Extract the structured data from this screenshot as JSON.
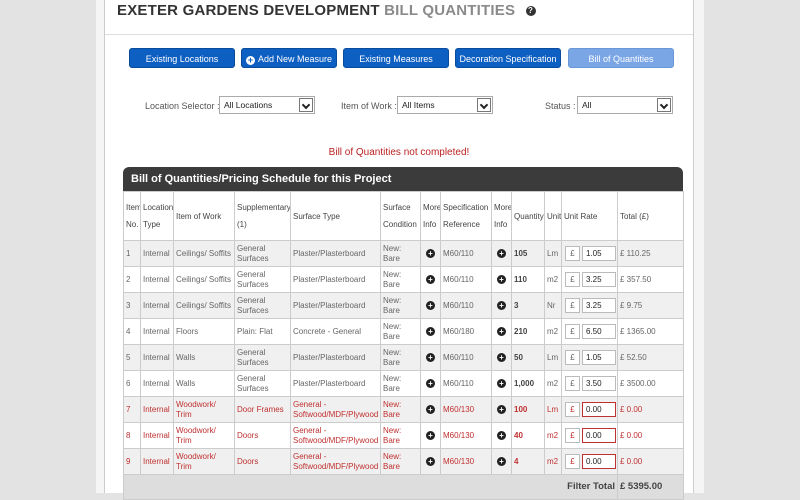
{
  "header": {
    "title_main": "EXETER GARDENS DEVELOPMENT",
    "title_sub": "BILL QUANTITIES",
    "help_glyph": "?"
  },
  "nav": {
    "existing_locations": "Existing Locations",
    "add_new_measure": "Add New Measure",
    "existing_measures": "Existing Measures",
    "decoration_specification": "Decoration Specification",
    "bill_of_quantities": "Bill of Quantities"
  },
  "filters": {
    "location_label": "Location Selector :",
    "location_value": "All Locations",
    "item_label": "Item of Work :",
    "item_value": "All Items",
    "status_label": "Status :",
    "status_value": "All"
  },
  "warning": "Bill of Quantities not completed!",
  "table": {
    "heading": "Bill of Quantities/Pricing Schedule for this Project",
    "columns": [
      "Item No.",
      "Location Type",
      "Item of Work",
      "Supplementary (1)",
      "Surface Type",
      "Surface Condition",
      "More Info",
      "Specification Reference",
      "More Info",
      "Quantity",
      "Unit",
      "Unit Rate",
      "Total (£)"
    ],
    "rows": [
      {
        "no": "1",
        "loc": "Internal",
        "item": "Ceilings/ Soffits",
        "supp": "General Surfaces",
        "surface": "Plaster/Plasterboard",
        "cond": "New: Bare",
        "spec": "M60/110",
        "qty": "105",
        "unit": "Lm",
        "cur": "£",
        "rate": "1.05",
        "total": "£ 110.25",
        "status": "done"
      },
      {
        "no": "2",
        "loc": "Internal",
        "item": "Ceilings/ Soffits",
        "supp": "General Surfaces",
        "surface": "Plaster/Plasterboard",
        "cond": "New: Bare",
        "spec": "M60/110",
        "qty": "110",
        "unit": "m2",
        "cur": "£",
        "rate": "3.25",
        "total": "£ 357.50",
        "status": "done"
      },
      {
        "no": "3",
        "loc": "Internal",
        "item": "Ceilings/ Soffits",
        "supp": "General Surfaces",
        "surface": "Plaster/Plasterboard",
        "cond": "New: Bare",
        "spec": "M60/110",
        "qty": "3",
        "unit": "Nr",
        "cur": "£",
        "rate": "3.25",
        "total": "£ 9.75",
        "status": "done"
      },
      {
        "no": "4",
        "loc": "Internal",
        "item": "Floors",
        "supp": "Plain: Flat",
        "surface": "Concrete - General",
        "cond": "New: Bare",
        "spec": "M60/180",
        "qty": "210",
        "unit": "m2",
        "cur": "£",
        "rate": "6.50",
        "total": "£ 1365.00",
        "status": "done"
      },
      {
        "no": "5",
        "loc": "Internal",
        "item": "Walls",
        "supp": "General Surfaces",
        "surface": "Plaster/Plasterboard",
        "cond": "New: Bare",
        "spec": "M60/110",
        "qty": "50",
        "unit": "Lm",
        "cur": "£",
        "rate": "1.05",
        "total": "£ 52.50",
        "status": "done"
      },
      {
        "no": "6",
        "loc": "Internal",
        "item": "Walls",
        "supp": "General Surfaces",
        "surface": "Plaster/Plasterboard",
        "cond": "New: Bare",
        "spec": "M60/110",
        "qty": "1,000",
        "unit": "m2",
        "cur": "£",
        "rate": "3.50",
        "total": "£ 3500.00",
        "status": "done"
      },
      {
        "no": "7",
        "loc": "Internal",
        "item": "Woodwork/ Trim",
        "supp": "Door Frames",
        "surface": "General - Softwood/MDF/Plywood",
        "cond": "New: Bare",
        "spec": "M60/130",
        "qty": "100",
        "unit": "Lm",
        "cur": "£",
        "rate": "0.00",
        "total": "£ 0.00",
        "status": "pending"
      },
      {
        "no": "8",
        "loc": "Internal",
        "item": "Woodwork/ Trim",
        "supp": "Doors",
        "surface": "General - Softwood/MDF/Plywood",
        "cond": "New: Bare",
        "spec": "M60/130",
        "qty": "40",
        "unit": "m2",
        "cur": "£",
        "rate": "0.00",
        "total": "£ 0.00",
        "status": "pending"
      },
      {
        "no": "9",
        "loc": "Internal",
        "item": "Woodwork/ Trim",
        "supp": "Doors",
        "surface": "General - Softwood/MDF/Plywood",
        "cond": "New: Bare",
        "spec": "M60/130",
        "qty": "4",
        "unit": "m2",
        "cur": "£",
        "rate": "0.00",
        "total": "£ 0.00",
        "status": "pending"
      }
    ],
    "filter_total_label": "Filter Total",
    "filter_total_value": "£ 5395.00"
  },
  "colors": {
    "button": "#0d5fc1",
    "button_active": "#7ba6e6",
    "warning": "#b22222",
    "pending_row": "#c03030",
    "table_header": "#3b3b3b"
  }
}
